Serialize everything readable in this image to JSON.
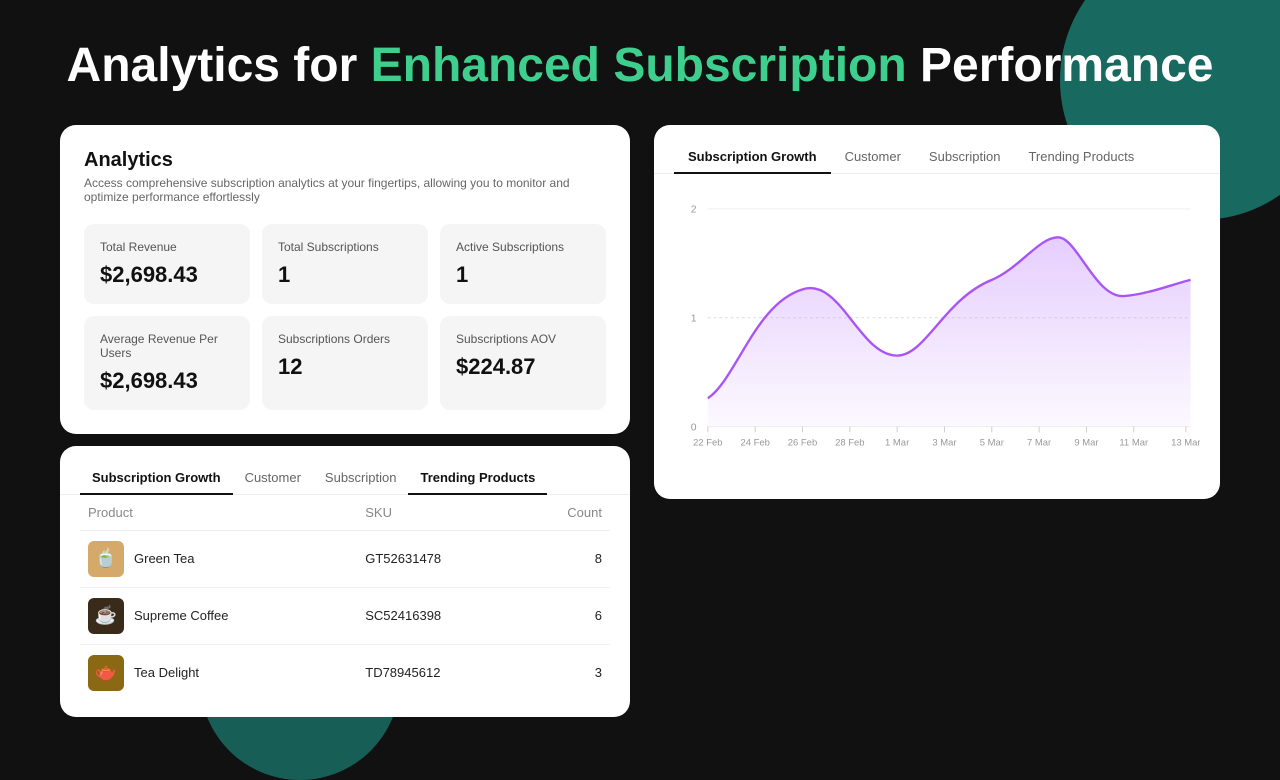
{
  "page": {
    "title_before": "Analytics for ",
    "title_highlight": "Enhanced Subscription",
    "title_after": " Performance"
  },
  "analytics_panel": {
    "title": "Analytics",
    "subtitle": "Access comprehensive subscription analytics at your fingertips, allowing you to monitor and optimize performance effortlessly",
    "metrics": [
      {
        "label": "Total Revenue",
        "value": "$2,698.43"
      },
      {
        "label": "Total Subscriptions",
        "value": "1"
      },
      {
        "label": "Active Subscriptions",
        "value": "1"
      },
      {
        "label": "Average Revenue Per Users",
        "value": "$2,698.43"
      },
      {
        "label": "Subscriptions Orders",
        "value": "12"
      },
      {
        "label": "Subscriptions AOV",
        "value": "$224.87"
      }
    ]
  },
  "table_panel": {
    "tabs": [
      {
        "label": "Subscription Growth",
        "active": true
      },
      {
        "label": "Customer",
        "active": false
      },
      {
        "label": "Subscription",
        "active": false
      },
      {
        "label": "Trending Products",
        "active": false
      }
    ],
    "columns": [
      "Product",
      "SKU",
      "Count"
    ],
    "rows": [
      {
        "name": "Green Tea",
        "sku": "GT52631478",
        "count": 8,
        "icon": "🍵",
        "icon_type": "green-tea"
      },
      {
        "name": "Supreme Coffee",
        "sku": "SC52416398",
        "count": 6,
        "icon": "☕",
        "icon_type": "coffee"
      },
      {
        "name": "Tea Delight",
        "sku": "TD78945612",
        "count": 3,
        "icon": "🫖",
        "icon_type": "tea-delight"
      }
    ]
  },
  "chart_panel": {
    "tabs": [
      {
        "label": "Subscription Growth",
        "active": true
      },
      {
        "label": "Customer",
        "active": false
      },
      {
        "label": "Subscription",
        "active": false
      },
      {
        "label": "Trending Products",
        "active": false
      }
    ],
    "y_labels": [
      "0",
      "1",
      "2"
    ],
    "x_labels": [
      "22 Feb",
      "24 Feb",
      "26 Feb",
      "28 Feb",
      "1 Mar",
      "3 Mar",
      "5 Mar",
      "7 Mar",
      "9 Mar",
      "11 Mar",
      "13 Mar"
    ]
  }
}
